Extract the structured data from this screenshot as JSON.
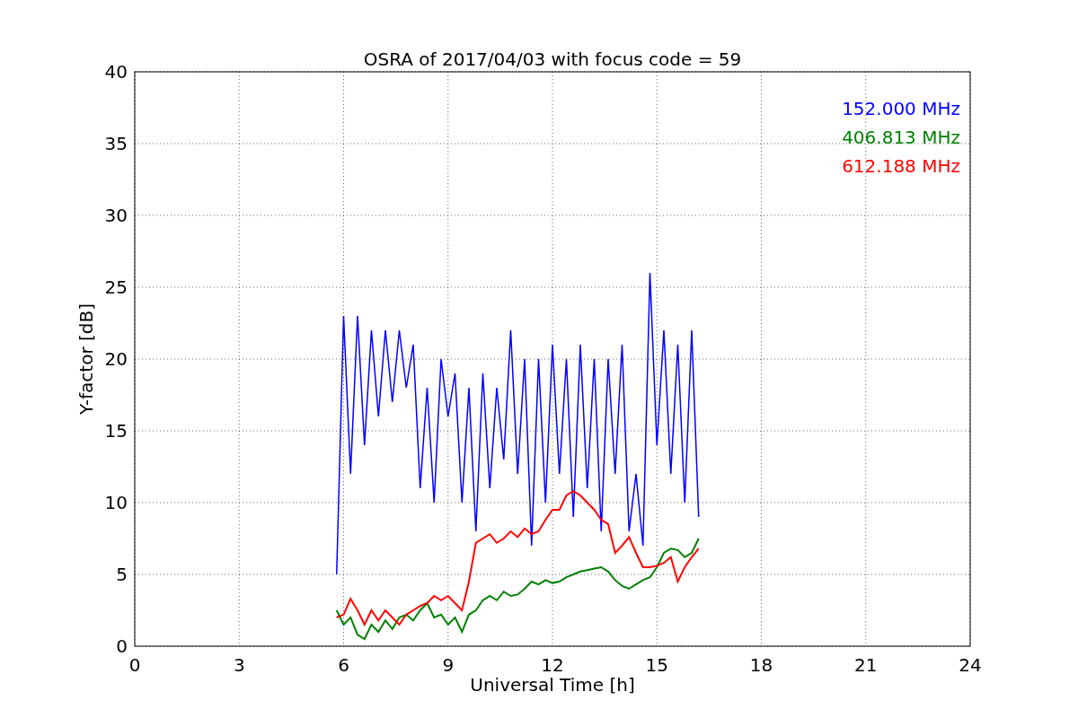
{
  "chart_data": {
    "type": "line",
    "title": "OSRA of 2017/04/03 with focus code = 59",
    "xlabel": "Universal Time [h]",
    "ylabel": "Y-factor [dB]",
    "x": [
      5.8,
      6.0,
      6.2,
      6.4,
      6.6,
      6.8,
      7.0,
      7.2,
      7.4,
      7.6,
      7.8,
      8.0,
      8.2,
      8.4,
      8.6,
      8.8,
      9.0,
      9.2,
      9.4,
      9.6,
      9.8,
      10.0,
      10.2,
      10.4,
      10.6,
      10.8,
      11.0,
      11.2,
      11.4,
      11.6,
      11.8,
      12.0,
      12.2,
      12.4,
      12.6,
      12.8,
      13.0,
      13.2,
      13.4,
      13.6,
      13.8,
      14.0,
      14.2,
      14.4,
      14.6,
      14.8,
      15.0,
      15.2,
      15.4,
      15.6,
      15.8,
      16.0,
      16.2
    ],
    "series": [
      {
        "name": "152.000 MHz",
        "color": "#0000ff",
        "values": [
          5,
          23,
          12,
          23,
          14,
          22,
          16,
          22,
          17,
          22,
          18,
          21,
          11,
          18,
          10,
          20,
          16,
          19,
          10,
          18,
          8,
          19,
          11,
          18,
          13,
          22,
          12,
          20,
          7,
          20,
          10,
          21,
          12,
          20,
          9,
          21,
          11,
          20,
          8,
          20,
          12,
          21,
          8,
          12,
          7,
          26,
          14,
          22,
          12,
          21,
          10,
          22,
          9
        ]
      },
      {
        "name": "406.813 MHz",
        "color": "#008000",
        "values": [
          2.5,
          1.5,
          2,
          0.8,
          0.5,
          1.5,
          1,
          1.8,
          1.2,
          2,
          2.2,
          1.8,
          2.5,
          3,
          2,
          2.2,
          1.5,
          2,
          1,
          2.2,
          2.5,
          3.2,
          3.5,
          3.2,
          3.8,
          3.5,
          3.6,
          4,
          4.5,
          4.3,
          4.6,
          4.4,
          4.5,
          4.8,
          5,
          5.2,
          5.3,
          5.4,
          5.5,
          5.2,
          4.6,
          4.2,
          4,
          4.3,
          4.6,
          4.8,
          5.5,
          6.5,
          6.8,
          6.7,
          6.2,
          6.5,
          7.5
        ]
      },
      {
        "name": "612.188 MHz",
        "color": "#ff0000",
        "values": [
          2,
          2.2,
          3.3,
          2.5,
          1.5,
          2.5,
          1.8,
          2.5,
          2,
          1.5,
          2.2,
          2.5,
          2.8,
          3,
          3.5,
          3.2,
          3.5,
          3,
          2.5,
          4.5,
          7.2,
          7.5,
          7.8,
          7.2,
          7.5,
          8,
          7.6,
          8.2,
          7.8,
          8,
          8.8,
          9.5,
          9.5,
          10.5,
          10.8,
          10.5,
          10,
          9.5,
          8.8,
          8.5,
          6.5,
          7,
          7.6,
          6.5,
          5.5,
          5.5,
          5.6,
          5.8,
          6.2,
          4.5,
          5.5,
          6.2,
          6.8
        ]
      }
    ],
    "xlim": [
      0,
      24
    ],
    "ylim": [
      0,
      40
    ],
    "xticks": [
      0,
      3,
      6,
      9,
      12,
      15,
      18,
      21,
      24
    ],
    "yticks": [
      0,
      5,
      10,
      15,
      20,
      25,
      30,
      35,
      40
    ],
    "grid": true
  }
}
